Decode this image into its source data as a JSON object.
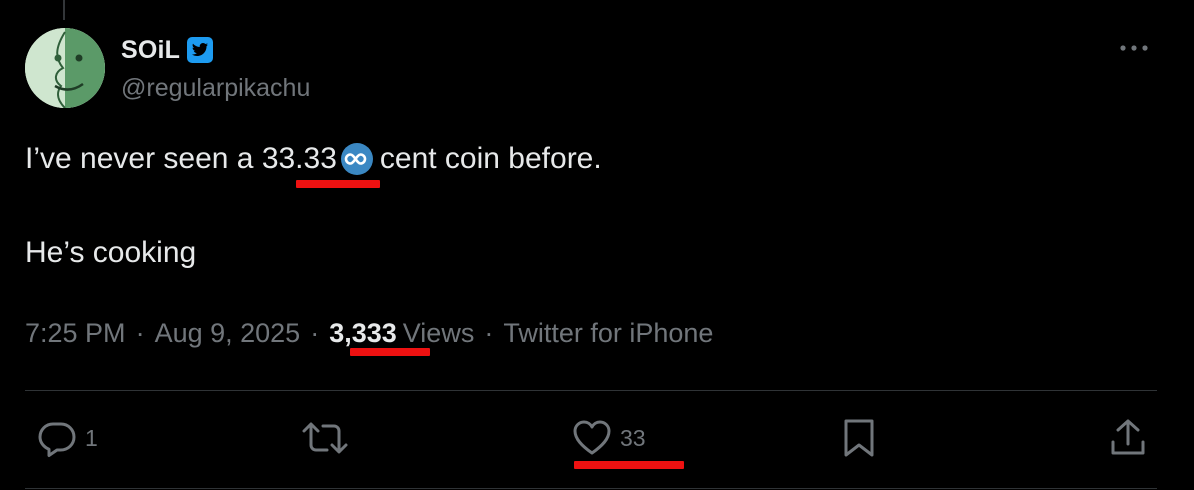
{
  "tweet": {
    "author": {
      "display_name": "SOiL",
      "handle": "@regularpikachu",
      "verified_icon": "twitter-bird-badge-icon"
    },
    "text_line1_prefix": "I’ve never seen a ",
    "text_line1_number": "33.33",
    "text_line1_emoji": "infinity-emoji",
    "text_line1_suffix": "cent coin before.",
    "text_line2": "He’s cooking",
    "meta": {
      "time": "7:25 PM",
      "date": "Aug 9, 2025",
      "views_count": "3,333",
      "views_label": "Views",
      "source": "Twitter for iPhone",
      "separator": "·"
    },
    "actions": {
      "reply_count": "1",
      "retweet_count": "",
      "like_count": "33"
    }
  },
  "colors": {
    "background": "#000000",
    "text": "#e7e9ea",
    "muted": "#71767b",
    "verified_blue": "#1d9bf0",
    "annotation_red": "#ee1111"
  }
}
